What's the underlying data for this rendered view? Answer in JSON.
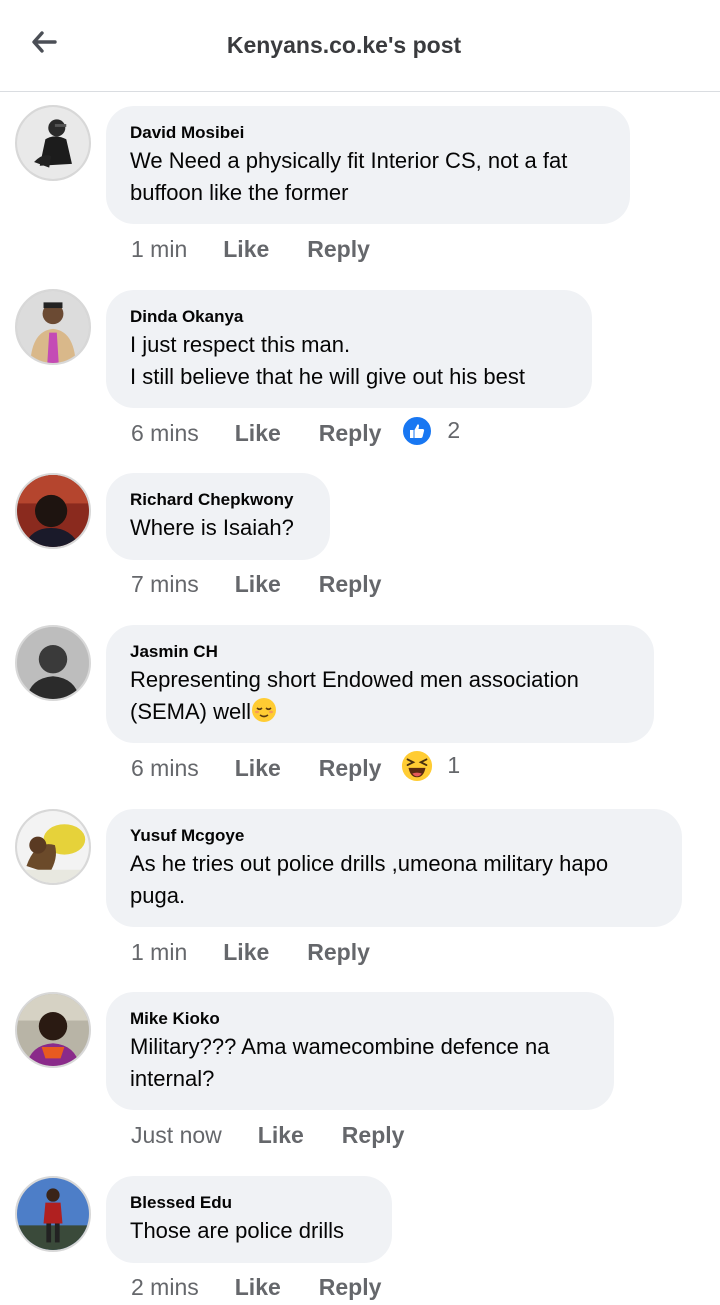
{
  "header": {
    "title": "Kenyans.co.ke's post",
    "back_icon": "arrow-left-icon"
  },
  "actions": {
    "like": "Like",
    "reply": "Reply"
  },
  "comments": [
    {
      "author": "David Mosibei",
      "text": "We Need a physically fit Interior CS, not a fat\nbuffoon like the former",
      "time": "1 min"
    },
    {
      "author": "Dinda Okanya",
      "text": "I just respect this man.\nI still believe that he will give out his best",
      "time": "6 mins",
      "reaction": {
        "icon": "thumbs-up-icon",
        "count": "2"
      }
    },
    {
      "author": "Richard Chepkwony",
      "text": "Where is Isaiah?",
      "time": "7 mins"
    },
    {
      "author": "Jasmin CH",
      "text": "Representing short Endowed men association\n(SEMA) well",
      "emoji": "relieved-face-emoji",
      "time": "6 mins",
      "reaction": {
        "icon": "laughing-face-icon",
        "count": "1"
      }
    },
    {
      "author": "Yusuf Mcgoye",
      "text": "As he tries out police drills ,umeona military hapo\npuga.",
      "time": "1 min"
    },
    {
      "author": "Mike Kioko",
      "text": "Military??? Ama wamecombine defence na\ninternal?",
      "time": "Just now"
    },
    {
      "author": "Blessed Edu",
      "text": "Those are police drills",
      "time": "2 mins"
    }
  ],
  "colors": {
    "bubble": "#f0f2f5",
    "meta": "#65676b",
    "like_blue": "#1877f2",
    "emoji_yellow": "#ffcc33"
  }
}
